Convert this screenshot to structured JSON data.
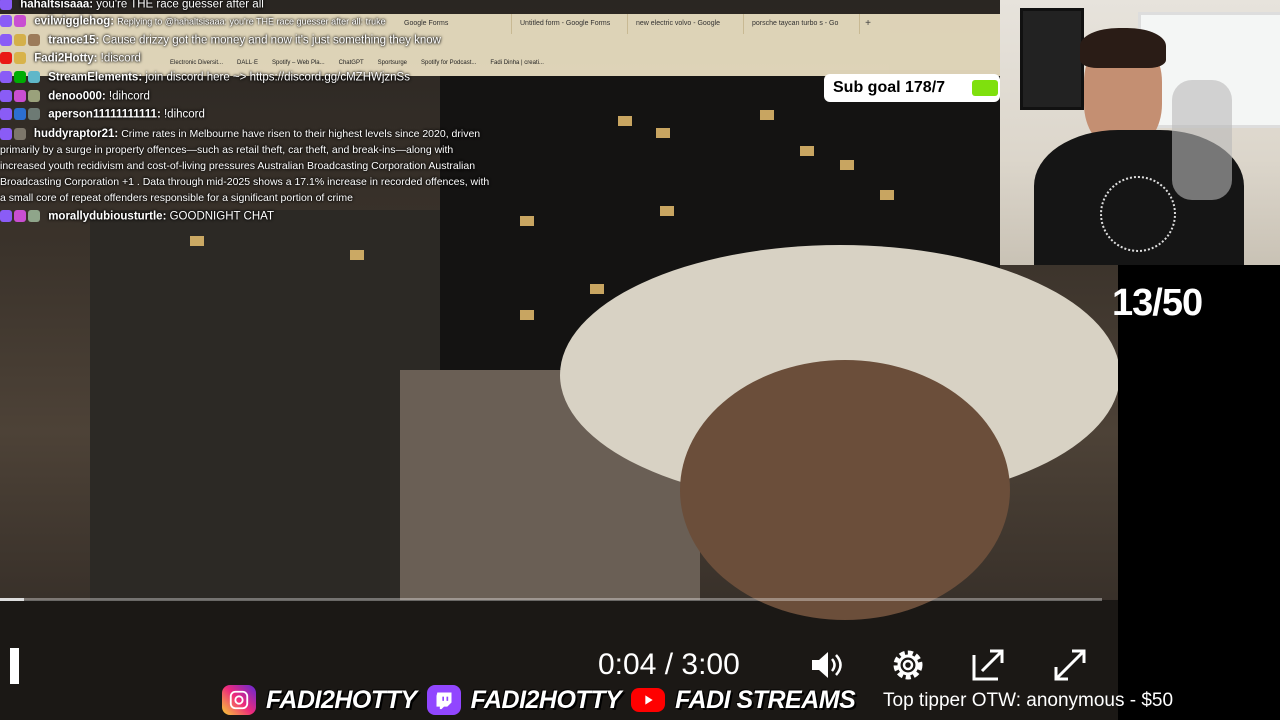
{
  "browser": {
    "tabs": [
      "Google Forms",
      "Untitled form - Google Forms",
      "new electric volvo - Google",
      "porsche taycan turbo s - Go"
    ],
    "new_tab": "+",
    "bookmarks": [
      "Electronic Diversit...",
      "DALL·E",
      "Spotify – Web Pla...",
      "ChatGPT",
      "Sportsurge",
      "Spotify for Podcast...",
      "Fadi Dinha | creati..."
    ]
  },
  "chat": {
    "lines": [
      {
        "user": "hahaltsisaaa:",
        "msg": "you're THE race guesser after all"
      },
      {
        "user": "evilwigglehog:",
        "msg": "Replying to @hahaltsisaaa: you're THE race guesser after all: truke"
      },
      {
        "user": "trance15:",
        "msg": "Cause drizzy got the money and now it's just something they know"
      },
      {
        "user": "Fadi2Hotty:",
        "msg": "!discord"
      },
      {
        "user": "StreamElements:",
        "msg": "join discord here ~> https://discord.gg/cMZHWjznSs"
      },
      {
        "user": "denoo000:",
        "msg": "!dihcord"
      },
      {
        "user": "aperson11111111111:",
        "msg": "!dihcord"
      },
      {
        "user": "huddyraptor21:",
        "msg": "Crime rates in Melbourne have risen to their highest levels since 2020, driven primarily by a surge in property offences—such as retail theft, car theft, and break-ins—along with increased youth recidivism and cost-of-living pressures Australian Broadcasting Corporation Australian Broadcasting Corporation +1 . Data through mid-2025 shows a 17.1% increase in recorded offences, with a small core of repeat offenders responsible for a significant portion of crime"
      },
      {
        "user": "morallydubiousturtle:",
        "msg": "GOODNIGHT CHAT"
      }
    ]
  },
  "overlay": {
    "sub_goal": "Sub goal 178/7",
    "counter": "13/50",
    "tipper": "Top tipper OTW: anonymous - $50"
  },
  "video": {
    "time": "0:04 / 3:00",
    "progress": 0.022
  },
  "socials": {
    "instagram": "FADI2HOTTY",
    "twitch": "FADI2HOTTY",
    "youtube": "FADI STREAMS"
  },
  "colors": {
    "sub_goal_fill": "#7fe00d",
    "twitch": "#9146ff",
    "youtube": "#ff0000"
  }
}
